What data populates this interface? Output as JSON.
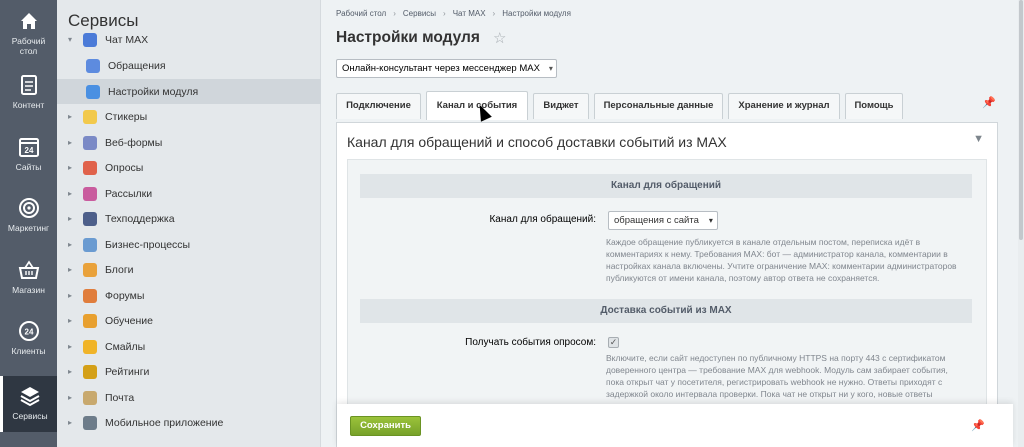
{
  "rail": [
    {
      "icon": "home-icon",
      "label": "Рабочий\nстол"
    },
    {
      "icon": "document-icon",
      "label": "Контент"
    },
    {
      "icon": "calendar-icon",
      "label": "Сайты",
      "badge": "24"
    },
    {
      "icon": "target-icon",
      "label": "Маркетинг"
    },
    {
      "icon": "basket-icon",
      "label": "Магазин"
    },
    {
      "icon": "clients-icon",
      "label": "Клиенты",
      "badge": "24"
    },
    {
      "icon": "layers-icon",
      "label": "Сервисы",
      "active": true
    }
  ],
  "sidebar": {
    "title": "Сервисы",
    "items": [
      {
        "label": "Чат MAX",
        "icon": "chat-icon",
        "expanded": true,
        "color": "#4b7bd8"
      },
      {
        "label": "Обращения",
        "icon": "chat-sub-icon",
        "sub": true,
        "color": "#5d8bdf"
      },
      {
        "label": "Настройки модуля",
        "icon": "gear-icon",
        "sub": true,
        "active": true,
        "color": "#4a90e2"
      },
      {
        "label": "Стикеры",
        "icon": "sticker-icon",
        "color": "#f2c94c"
      },
      {
        "label": "Веб-формы",
        "icon": "webform-icon",
        "color": "#7b8ac6"
      },
      {
        "label": "Опросы",
        "icon": "poll-icon",
        "color": "#e0624b"
      },
      {
        "label": "Рассылки",
        "icon": "mailing-icon",
        "color": "#c95c9e"
      },
      {
        "label": "Техподдержка",
        "icon": "support-icon",
        "color": "#4d5f8a"
      },
      {
        "label": "Бизнес-процессы",
        "icon": "bizproc-icon",
        "color": "#6a9bd1"
      },
      {
        "label": "Блоги",
        "icon": "blog-icon",
        "color": "#e9a23b"
      },
      {
        "label": "Форумы",
        "icon": "forum-icon",
        "color": "#e07d3c"
      },
      {
        "label": "Обучение",
        "icon": "learning-icon",
        "color": "#e8a02f"
      },
      {
        "label": "Смайлы",
        "icon": "smile-icon",
        "color": "#f0b429"
      },
      {
        "label": "Рейтинги",
        "icon": "rating-icon",
        "color": "#d4a017"
      },
      {
        "label": "Почта",
        "icon": "mail-icon",
        "color": "#c8a96e"
      },
      {
        "label": "Мобильное приложение",
        "icon": "mobile-icon",
        "color": "#6d7c8a"
      }
    ]
  },
  "breadcrumbs": [
    "Рабочий стол",
    "Сервисы",
    "Чат MAX",
    "Настройки модуля"
  ],
  "page_title": "Настройки модуля",
  "module_select": "Онлайн-консультант через мессенджер MAX",
  "tabs": [
    {
      "label": "Подключение"
    },
    {
      "label": "Канал и события",
      "active": true
    },
    {
      "label": "Виджет"
    },
    {
      "label": "Персональные данные"
    },
    {
      "label": "Хранение и журнал"
    },
    {
      "label": "Помощь"
    }
  ],
  "panel": {
    "title": "Канал для обращений и способ доставки событий из MAX",
    "section1": {
      "title": "Канал для обращений",
      "field_label": "Канал для обращений:",
      "field_value": "обращения с сайта",
      "help": "Каждое обращение публикуется в канале отдельным постом, переписка идёт в комментариях к нему. Требования MAX: бот — администратор канала, комментарии в настройках канала включены. Учтите ограничение MAX: комментарии администраторов публикуются от имени канала, поэтому автор ответа не сохраняется."
    },
    "section2": {
      "title": "Доставка событий из MAX",
      "field_label": "Получать события опросом:",
      "checked": true,
      "help": "Включите, если сайт недоступен по публичному HTTPS на порту 443 с сертификатом доверенного центра — требование MAX для webhook. Модуль сам забирает события, пока открыт чат у посетителя, регистрировать webhook не нужно. Ответы приходят с задержкой около интервала проверки. Пока чат не открыт ни у кого, новые ответы"
    }
  },
  "save_label": "Сохранить"
}
